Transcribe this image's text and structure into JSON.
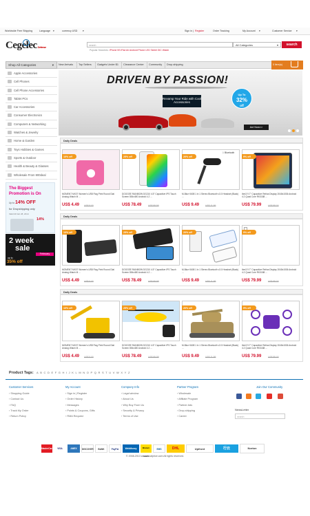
{
  "topbar": {
    "free_shipping": "Worldwide Free Shipping",
    "language": "Language",
    "currency": "currency USD",
    "sign_in": "Sign in",
    "or": "|",
    "register": "Register",
    "order_tracking": "Order Tracking",
    "my_account": "My Account",
    "customer_service": "Customer Service"
  },
  "logo": {
    "text": "Cegelec",
    "suffix": "Defense"
  },
  "search": {
    "placeholder": "search",
    "category": "All Categories",
    "button": "search",
    "popular_label": "Popular Searches:",
    "popular": "iPhone 5S  iPad Air  Android Phone  LED  Tablet  GIC  Watch"
  },
  "nav": {
    "shop_all": "Shop All Categories",
    "items": [
      "New Arrivals",
      "Top Sellers",
      "Gadgets Under $1",
      "Clearance Center",
      "Community",
      "Drop-shipping"
    ],
    "cart": "0 item(s)"
  },
  "sidebar": [
    "Apple Accessories",
    "Cell Phones",
    "Cell Phone Accessories",
    "Tablet PCs",
    "Car Accessories",
    "Consumer Electronics",
    "Computers & Networking",
    "Watches & Jewelry",
    "Home & Garden",
    "Toys Hobbies & Games",
    "Sports & Outdoor",
    "Health & Beauty & Glasses",
    "Wholesale From 900deal"
  ],
  "promos": {
    "p1_line1": "The Biggest",
    "p1_line2": "Promotion is On",
    "p1_up": "Up to",
    "p1_off": "14% OFF",
    "p1_for": "for Dropshipping only",
    "p1_valid": "Valid till Feb 28, 2014",
    "p1_badge": "14%",
    "p2_line1": "2 week",
    "p2_line2": "sale",
    "p2_month": "February",
    "p2_upto": "up to",
    "p2_off": "35% off"
  },
  "banner": {
    "title": "DRIVEN BY PASSION!",
    "subtitle": "Revamp Your Ride with Cool Accessories",
    "up_to": "Up To",
    "percent": "32%",
    "off": "off",
    "cta": "Act Now>>"
  },
  "sections": [
    {
      "title": "Daily Deals",
      "products": [
        {
          "tag": "10% off",
          "name": "MOMENT MX07 Women's USB Flag Print Round Dial Analog Watch M ...",
          "price": "US$ 4.49",
          "old": "US$ 5.00"
        },
        {
          "tag": "25% off",
          "name": "DOOGEE RAINBOW DG210 4.5\" Capacitive IPS Touch Screen 854x480 Android 4.2 ...",
          "price": "US$ 78.49",
          "old": "US$ 99.99"
        },
        {
          "tag": "20% off",
          "name": "M-Blue K608 1 in 1 Stereo Bluetooth v3.0 Headset (Black) ...",
          "price": "US$ 9.49",
          "old": "US$ 11.99"
        },
        {
          "tag": "9% off",
          "name": "Ibm3 9.7\" Capacitive Retina Display 2048x1536 Android 4.2 Quad Core RK3188 ...",
          "price": "US$ 79.99",
          "old": "US$ 89.00"
        }
      ]
    },
    {
      "title": "Daily Deals",
      "products": [
        {
          "tag": "10% off",
          "name": "MOMENT MX07 Women's USB Flag Print Round Dial Analog Watch M ...",
          "price": "US$ 4.49",
          "old": "US$ 5.00"
        },
        {
          "tag": "25% off",
          "name": "DOOGEE RAINBOW DG210 4.5\" Capacitive IPS Touch Screen 854x480 Android 4.2 ...",
          "price": "US$ 78.49",
          "old": "US$ 99.99"
        },
        {
          "tag": "20% off",
          "name": "M-Blue K608 1 in 1 Stereo Bluetooth v3.0 Headset (Black) ...",
          "price": "US$ 9.49",
          "old": "US$ 11.99"
        },
        {
          "tag": "9% off",
          "name": "Ibm3 9.7\" Capacitive Retina Display 2048x1536 Android 4.2 Quad Core RK3188 ...",
          "price": "US$ 79.99",
          "old": "US$ 89.00"
        }
      ]
    },
    {
      "title": "Daily Deals",
      "products": [
        {
          "tag": "10% off",
          "name": "MOMENT MX07 Women's USB Flag Print Round Dial Analog Watch M ...",
          "price": "US$ 4.49",
          "old": "US$ 5.00"
        },
        {
          "tag": "25% off",
          "name": "DOOGEE RAINBOW DG210 4.5\" Capacitive IPS Touch Screen 854x480 Android 4.2 ...",
          "price": "US$ 78.49",
          "old": "US$ 99.99"
        },
        {
          "tag": "20% off",
          "name": "M-Blue K608 1 in 1 Stereo Bluetooth v3.0 Headset (Black) ...",
          "price": "US$ 9.49",
          "old": "US$ 11.99"
        },
        {
          "tag": "9% off",
          "name": "Ibm3 9.7\" Capacitive Retina Display 2048x1536 Android 4.2 Quad Core RK3188 ...",
          "price": "US$ 79.99",
          "old": "US$ 89.00"
        }
      ]
    }
  ],
  "product_tags": {
    "label": "Product Tags:",
    "letters": [
      "A",
      "B",
      "C",
      "D",
      "E",
      "F",
      "G",
      "H",
      "I",
      "J",
      "K",
      "L",
      "M",
      "N",
      "O",
      "P",
      "Q",
      "R",
      "S",
      "T",
      "U",
      "V",
      "W",
      "X",
      "Y",
      "Z"
    ]
  },
  "footer": {
    "columns": [
      {
        "title": "Customer Services",
        "links": [
          "Shopping Guide",
          "Contact Us",
          "FAQ",
          "Track My Order",
          "Return Policy"
        ]
      },
      {
        "title": "My Account",
        "links": [
          "Sign in | Register",
          "Order History",
          "Messages",
          "Points & Coupons, Gifts",
          "RMA Request"
        ]
      },
      {
        "title": "Company Info",
        "links": [
          "Legal window",
          "About Us",
          "Why Buy From Us",
          "Security & Privacy",
          "Terms of Use"
        ]
      },
      {
        "title": "Partner Program",
        "links": [
          "Wholesale",
          "Affiliate Program",
          "Partner Ads",
          "Drop-shipping",
          "Career"
        ]
      }
    ],
    "community_title": "Join Our Community",
    "newsletter": "NewsLetter",
    "newsletter_placeholder": "search",
    "payments": [
      "MasterCard",
      "VISA",
      "AMEX",
      "DISCOVER",
      "BANK",
      "PayPal",
      "WebMoney",
      "Western Union",
      "EMS",
      "DHL",
      "Upfront",
      "行云",
      "Norton"
    ],
    "copyright": "© 2008-2013 www.focalprice.com All rights reserved."
  },
  "colors": {
    "brand_red": "#d2112c",
    "accent_blue": "#0b6fb4",
    "deal_orange": "#f39a1d"
  }
}
